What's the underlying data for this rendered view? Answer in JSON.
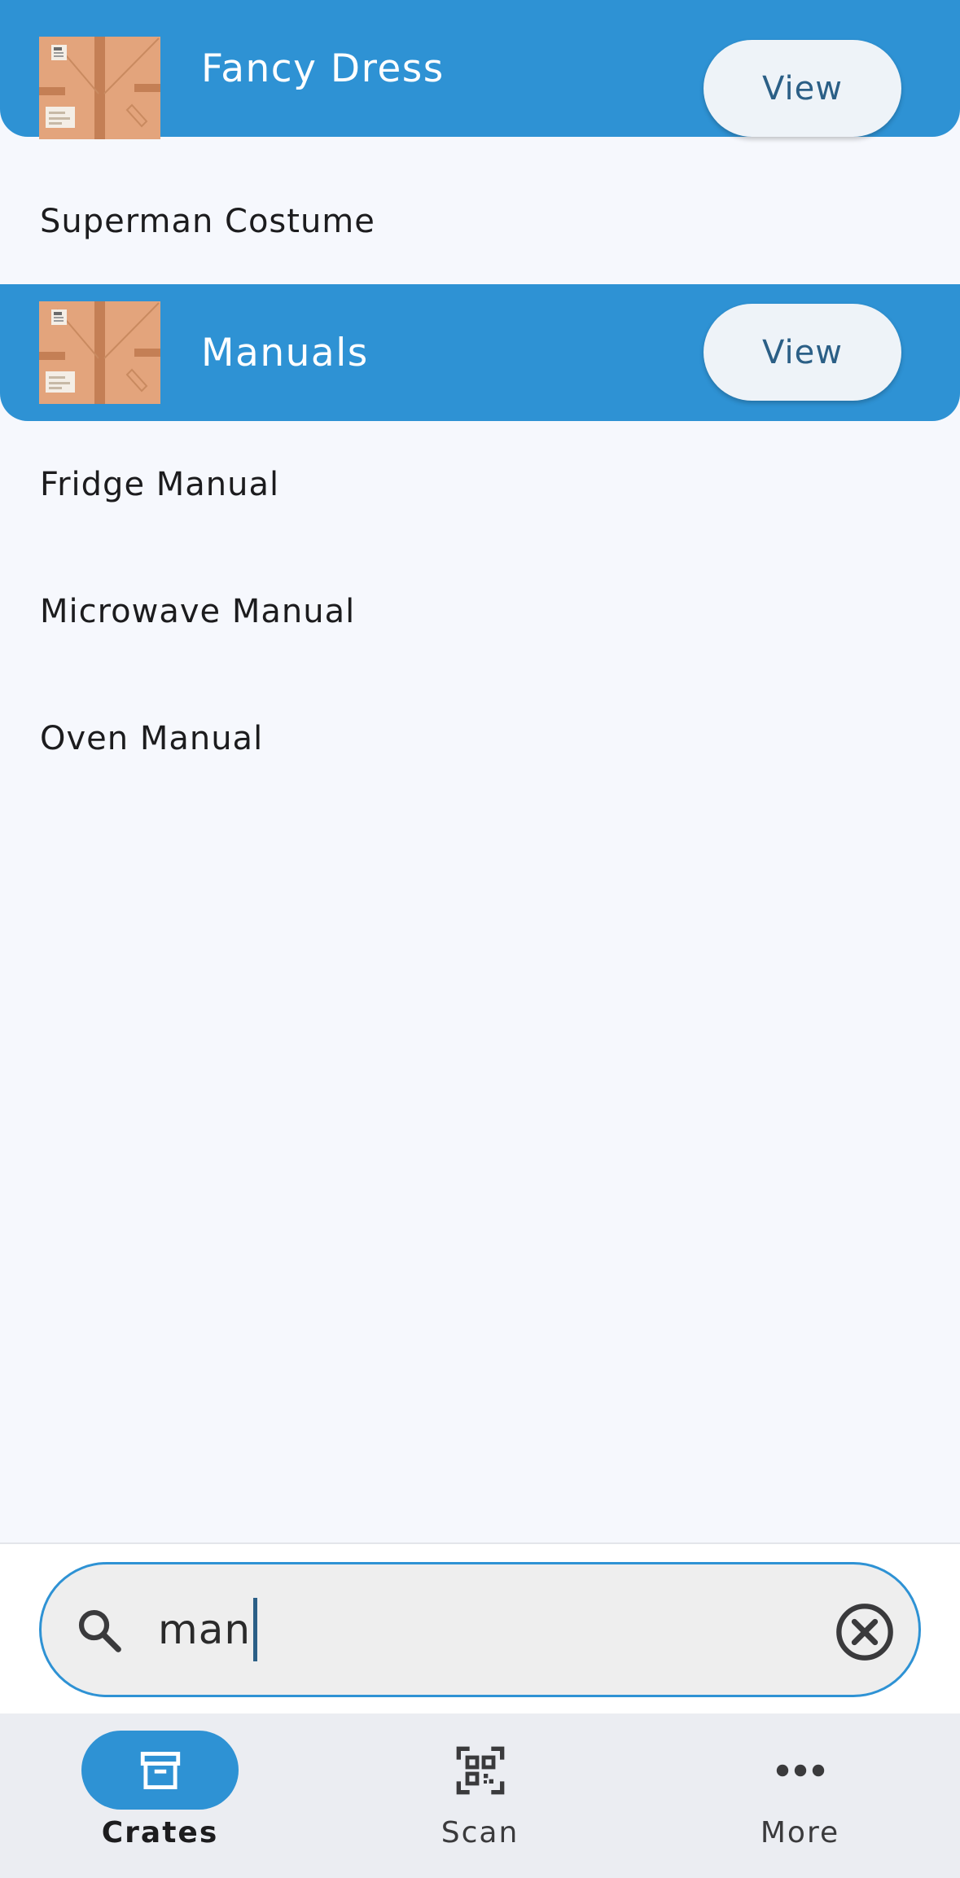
{
  "crates": [
    {
      "name": "Fancy Dress",
      "button_label": "View",
      "items": [
        "Superman Costume"
      ]
    },
    {
      "name": "Manuals",
      "button_label": "View",
      "items": [
        "Fridge Manual",
        "Microwave Manual",
        "Oven Manual"
      ]
    }
  ],
  "search": {
    "value": "man",
    "icon": "search-icon",
    "clear_icon": "clear-circle-icon"
  },
  "tabs": [
    {
      "label": "Crates",
      "icon": "archive-box-icon",
      "active": true
    },
    {
      "label": "Scan",
      "icon": "qr-code-icon",
      "active": false
    },
    {
      "label": "More",
      "icon": "more-horizontal-icon",
      "active": false
    }
  ],
  "colors": {
    "accent": "#2e92d4",
    "background": "#f6f8fd",
    "button_text": "#2b5f86",
    "tabbar": "#ebedf2"
  }
}
